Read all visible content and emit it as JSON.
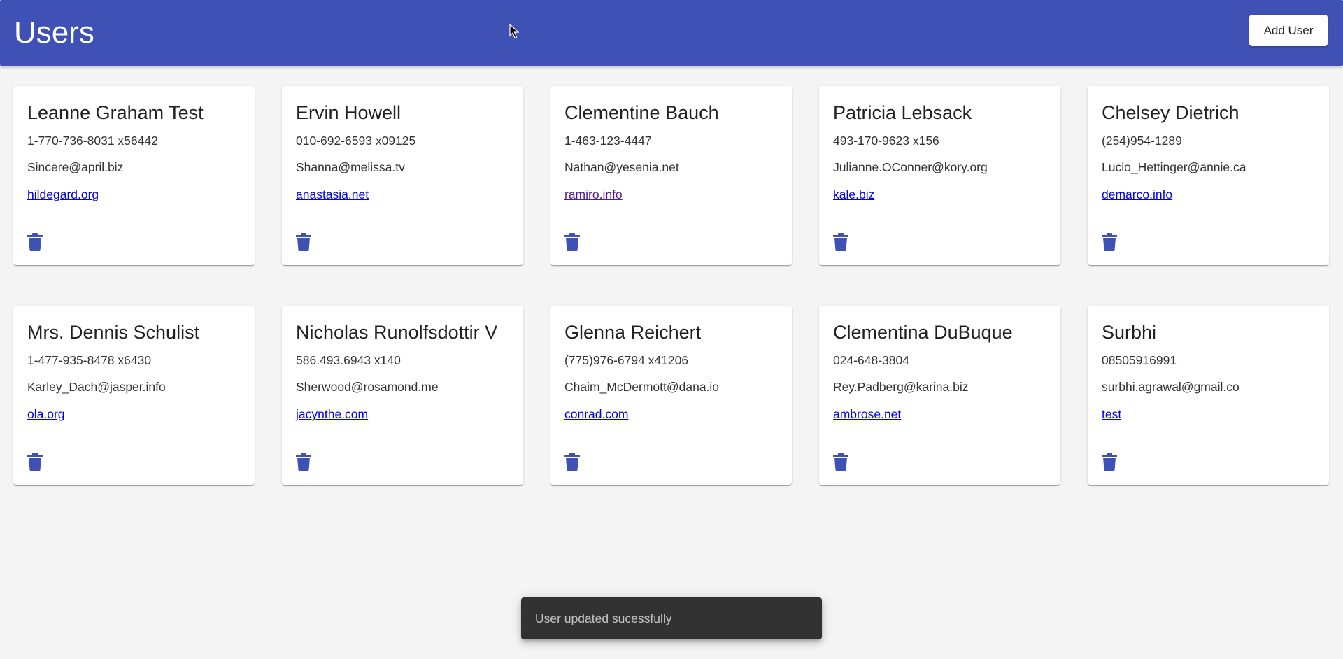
{
  "header": {
    "title": "Users",
    "add_user_label": "Add User"
  },
  "colors": {
    "primary": "#3f51b5",
    "background": "#f4f4f4",
    "link": "#0000ee",
    "visited_link": "#551a8b",
    "snackbar": "#323232"
  },
  "users": [
    {
      "name": "Leanne Graham Test",
      "phone": "1-770-736-8031 x56442",
      "email": "Sincere@april.biz",
      "website": "hildegard.org",
      "visited": false
    },
    {
      "name": "Ervin Howell",
      "phone": "010-692-6593 x09125",
      "email": "Shanna@melissa.tv",
      "website": "anastasia.net",
      "visited": false
    },
    {
      "name": "Clementine Bauch",
      "phone": "1-463-123-4447",
      "email": "Nathan@yesenia.net",
      "website": "ramiro.info",
      "visited": true
    },
    {
      "name": "Patricia Lebsack",
      "phone": "493-170-9623 x156",
      "email": "Julianne.OConner@kory.org",
      "website": "kale.biz",
      "visited": false
    },
    {
      "name": "Chelsey Dietrich",
      "phone": "(254)954-1289",
      "email": "Lucio_Hettinger@annie.ca",
      "website": "demarco.info",
      "visited": false
    },
    {
      "name": "Mrs. Dennis Schulist",
      "phone": "1-477-935-8478 x6430",
      "email": "Karley_Dach@jasper.info",
      "website": "ola.org",
      "visited": false
    },
    {
      "name": "Nicholas Runolfsdottir V",
      "phone": "586.493.6943 x140",
      "email": "Sherwood@rosamond.me",
      "website": "jacynthe.com",
      "visited": false
    },
    {
      "name": "Glenna Reichert",
      "phone": "(775)976-6794 x41206",
      "email": "Chaim_McDermott@dana.io",
      "website": "conrad.com",
      "visited": false
    },
    {
      "name": "Clementina DuBuque",
      "phone": "024-648-3804",
      "email": "Rey.Padberg@karina.biz",
      "website": "ambrose.net",
      "visited": false
    },
    {
      "name": "Surbhi",
      "phone": "08505916991",
      "email": "surbhi.agrawal@gmail.co",
      "website": "test",
      "visited": false
    }
  ],
  "delete_icon": "trash-icon",
  "snackbar": {
    "message": "User updated sucessfully"
  }
}
